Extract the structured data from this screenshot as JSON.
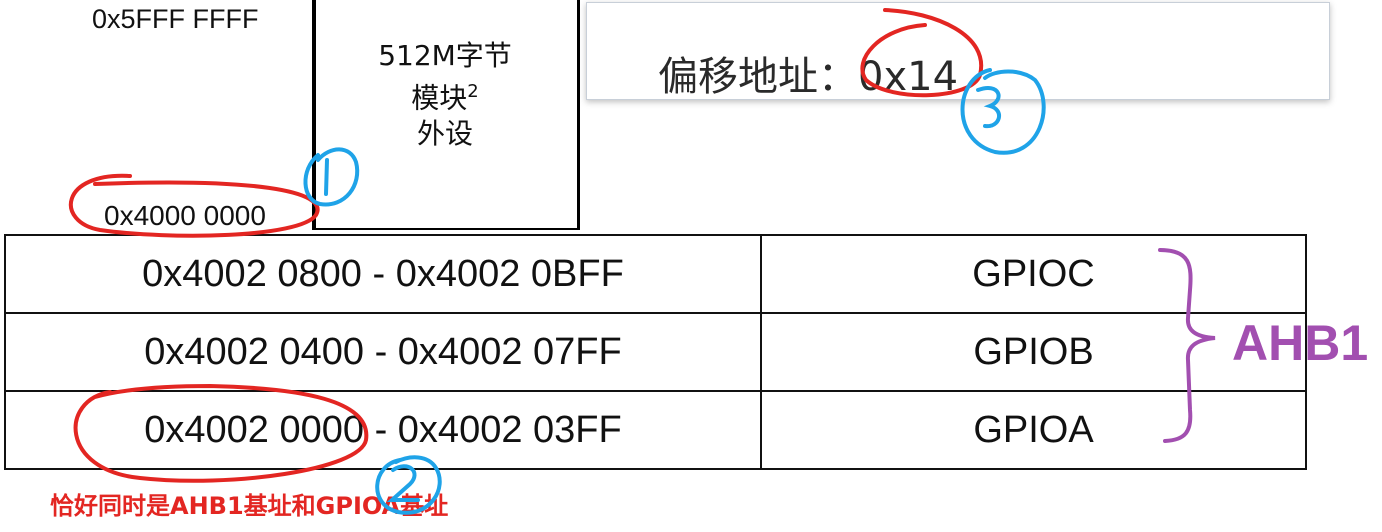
{
  "memory_map": {
    "top_address": "0x5FFF FFFF",
    "block_line1": "512M字节",
    "block_line2": "模块",
    "block_superscript": "2",
    "block_line3": "外设",
    "bottom_address": "0x4000 0000"
  },
  "offset_panel": {
    "label": "偏移地址：0x14"
  },
  "gpio_table": {
    "rows": [
      {
        "range": "0x4002 0800 - 0x4002 0BFF",
        "name": "GPIOC"
      },
      {
        "range": "0x4002 0400 - 0x4002 07FF",
        "name": "GPIOB"
      },
      {
        "range": "0x4002 0000 - 0x4002 03FF",
        "name": "GPIOA"
      }
    ]
  },
  "annotations": {
    "bus_label": "AHB1",
    "note": "恰好同时是AHB1基址和GPIOA基址",
    "colors": {
      "red": "#e32622",
      "blue": "#1fa3e8",
      "purple": "#a24fb0"
    }
  }
}
